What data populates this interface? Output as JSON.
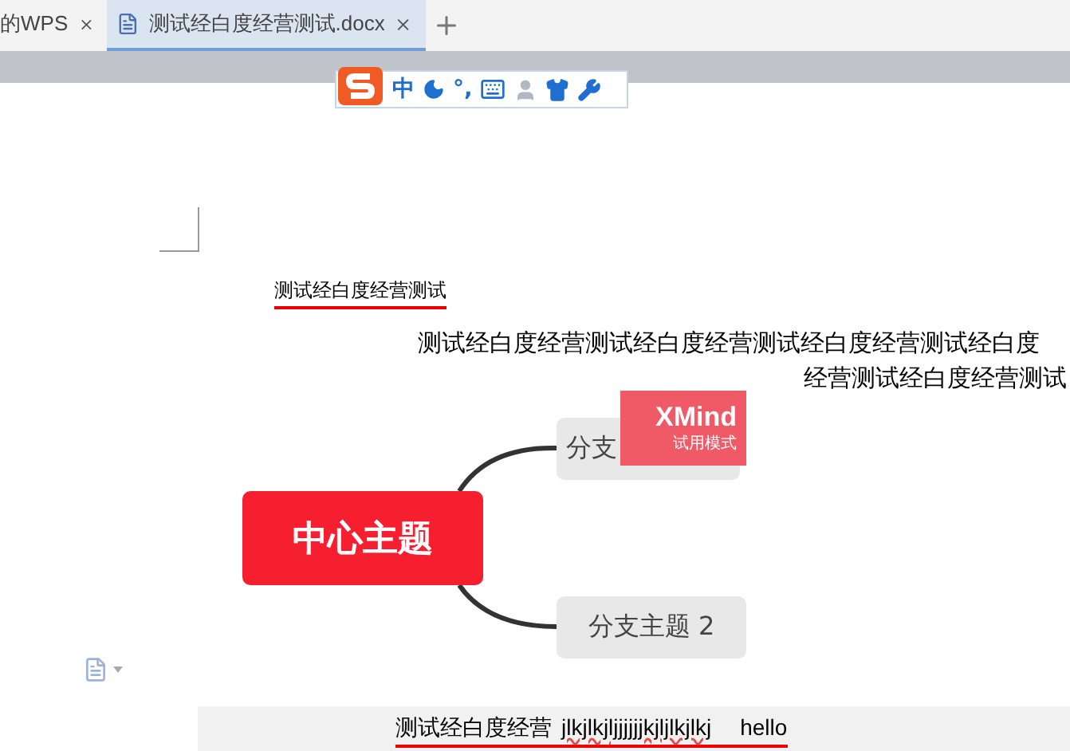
{
  "tabs": [
    {
      "label": "的WPS",
      "selected": false
    },
    {
      "label": "测试经白度经营测试.docx",
      "selected": true
    }
  ],
  "ime_toolbar": {
    "mode": "中",
    "punctuation": "°,"
  },
  "document": {
    "heading": "测试经白度经营测试",
    "paragraph_lines": [
      "测试经白度经营测试经白度经营测试经白度经营测试经白度",
      "经营测试经白度经营测试"
    ],
    "mindmap": {
      "central": "中心主题",
      "branches": [
        "分支",
        "分支主题 2"
      ],
      "trial_badge": {
        "title": "XMind",
        "subtitle": "试用模式"
      }
    },
    "footer_line": {
      "chinese": "测试经白度经营",
      "latin": "jlkjlkjljjjjjjkjljlkjlkj",
      "word": "hello"
    }
  }
}
